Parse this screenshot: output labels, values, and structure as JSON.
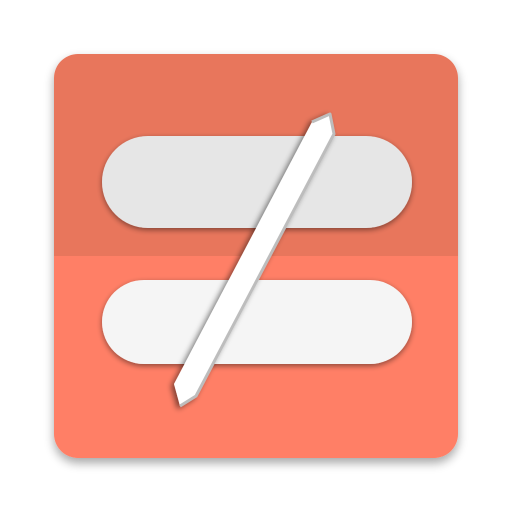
{
  "app_icon": {
    "name": "not-equal-app-icon",
    "colors": {
      "tile_top": "#E8765C",
      "tile_bottom": "#FF7F66",
      "bar_top": "#E6E6E6",
      "bar_bottom": "#F5F5F5",
      "slash": "#FFFFFF",
      "slash_edge": "#BDBDBD",
      "shadow": "#000000"
    }
  }
}
